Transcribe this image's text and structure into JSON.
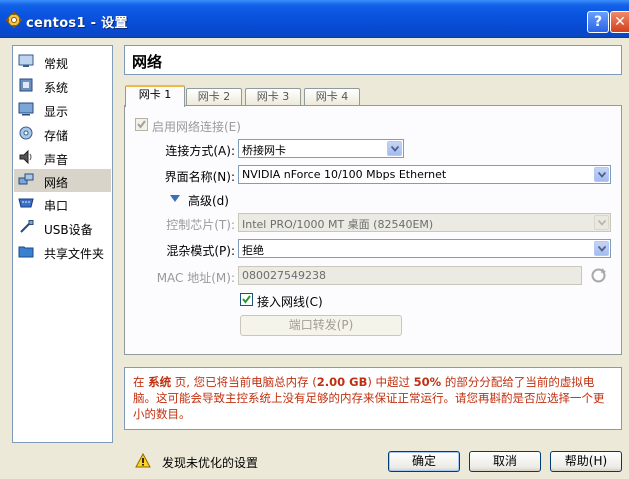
{
  "window": {
    "title": "centos1 - 设置",
    "help_label": "?",
    "close_label": "✕"
  },
  "nav": {
    "items": [
      {
        "label": "常规",
        "icon": "general-icon"
      },
      {
        "label": "系统",
        "icon": "system-icon"
      },
      {
        "label": "显示",
        "icon": "display-icon"
      },
      {
        "label": "存储",
        "icon": "storage-icon"
      },
      {
        "label": "声音",
        "icon": "audio-icon"
      },
      {
        "label": "网络",
        "icon": "network-icon",
        "selected": true
      },
      {
        "label": "串口",
        "icon": "serial-port-icon"
      },
      {
        "label": "USB设备",
        "icon": "usb-icon"
      },
      {
        "label": "共享文件夹",
        "icon": "shared-folder-icon"
      }
    ]
  },
  "page": {
    "title": "网络"
  },
  "tabs": [
    "网卡 1",
    "网卡 2",
    "网卡 3",
    "网卡 4"
  ],
  "adapter": {
    "enable_label": "启用网络连接(E)",
    "enabled": true,
    "attached_label": "连接方式(A):",
    "attached_value": "桥接网卡",
    "name_label": "界面名称(N):",
    "name_value": "NVIDIA nForce 10/100 Mbps Ethernet",
    "advanced_label": "高级(d)",
    "chip_label": "控制芯片(T):",
    "chip_value": "Intel PRO/1000 MT 桌面 (82540EM)",
    "promisc_label": "混杂模式(P):",
    "promisc_value": "拒绝",
    "mac_label": "MAC 地址(M):",
    "mac_value": "080027549238",
    "cable_label": "接入网线(C)",
    "cable_connected": true,
    "port_forward_label": "端口转发(P)"
  },
  "warning": {
    "p1": "在 ",
    "p2": "系统",
    "p3": " 页, 您已将当前电脑总内存 (",
    "p4": "2.00 GB",
    "p5": ") 中超过 ",
    "p6": "50%",
    "p7": " 的部分分配给了当前的虚拟电脑。这可能会导致主控系统上没有足够的内存来保证正常运行。请您再斟酌是否应选择一个更小的数目。"
  },
  "status": {
    "text": "发现未优化的设置",
    "icon": "warning-icon"
  },
  "buttons": {
    "ok": "确定",
    "cancel": "取消",
    "help": "帮助(H)"
  },
  "colors": {
    "warning_text": "#c03010",
    "titlebar": "#0a54df"
  }
}
